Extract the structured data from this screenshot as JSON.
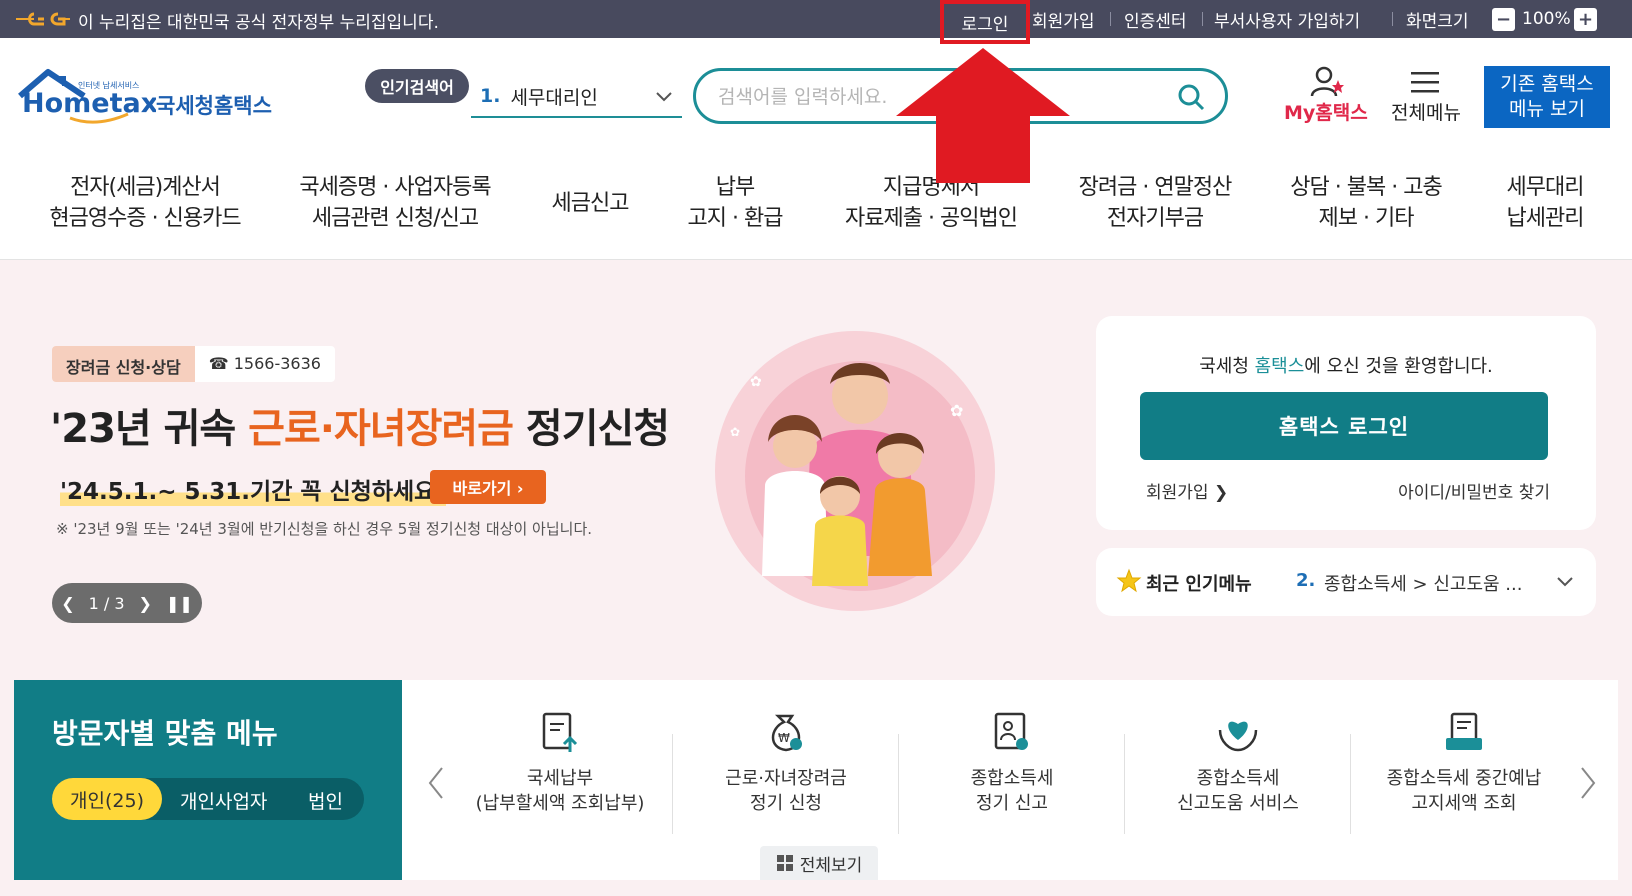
{
  "gov_bar": {
    "notice": "이 누리집은 대한민국 공식 전자정부 누리집입니다.",
    "login": "로그인",
    "signup": "회원가입",
    "cert_center": "인증센터",
    "dept_signup": "부서사용자 가입하기",
    "screen_size": "화면크기",
    "zoom_minus": "−",
    "zoom_value": "100%",
    "zoom_plus": "+"
  },
  "header": {
    "logo_small": "인터넷 납세서비스",
    "logo_brand": "Hometax.",
    "logo_kr": "국세청홈택스",
    "popular_badge": "인기검색어",
    "popular_num": "1.",
    "popular_term": "세무대리인",
    "search_placeholder": "검색어를 입력하세요.",
    "my_hometax": "My홈택스",
    "all_menu": "전체메뉴",
    "old_menu_line1": "기존 홈택스",
    "old_menu_line2": "메뉴 보기"
  },
  "nav": [
    {
      "l1": "전자(세금)계산서",
      "l2": "현금영수증 · 신용카드"
    },
    {
      "l1": "국세증명 · 사업자등록",
      "l2": "세금관련 신청/신고"
    },
    {
      "l1": "세금신고",
      "l2": ""
    },
    {
      "l1": "납부",
      "l2": "고지 · 환급"
    },
    {
      "l1": "지급명세서",
      "l2": "자료제출 · 공익법인"
    },
    {
      "l1": "장려금 · 연말정산",
      "l2": "전자기부금"
    },
    {
      "l1": "상담 · 불복 · 고충",
      "l2": "제보 · 기타"
    },
    {
      "l1": "세무대리",
      "l2": "납세관리"
    }
  ],
  "banner": {
    "tag": "장려금 신청·상담",
    "phone": "☎ 1566-3636",
    "title_pre": "'23년 귀속 ",
    "title_hl": "근로·자녀장려금",
    "title_post": " 정기신청",
    "subtitle": "'24.5.1.~ 5.31.기간 꼭 신청하세요!",
    "go_button": "바로가기 ›",
    "note": "※ '23년 9월 또는 '24년 3월에 반기신청을 하신 경우 5월 정기신청 대상이 아닙니다.",
    "pager": "1 / 3"
  },
  "login_card": {
    "welcome_pre": "국세청 ",
    "welcome_hl": "홈택스",
    "welcome_post": "에 오신 것을 환영합니다.",
    "login_button": "홈택스 로그인",
    "join": "회원가입 ❯",
    "find": "아이디/비밀번호 찾기"
  },
  "recent": {
    "title": "최근 인기메뉴",
    "num": "2.",
    "text": "종합소득세 > 신고도움 ..."
  },
  "visitor": {
    "title": "방문자별 맞춤 메뉴",
    "tab_personal": "개인(25)",
    "tab_business": "개인사업자",
    "tab_corp": "법인"
  },
  "quick": [
    {
      "l1": "국세납부",
      "l2": "(납부할세액 조회납부)"
    },
    {
      "l1": "근로·자녀장려금",
      "l2": "정기 신청"
    },
    {
      "l1": "종합소득세",
      "l2": "정기 신고"
    },
    {
      "l1": "종합소득세",
      "l2": "신고도움 서비스"
    },
    {
      "l1": "종합소득세 중간예납",
      "l2": "고지세액 조회"
    }
  ],
  "all_view": "전체보기",
  "colors": {
    "teal": "#117d86",
    "gov_bar": "#484a5e",
    "accent_orange": "#e8641f",
    "highlight_red": "#e01a22"
  }
}
